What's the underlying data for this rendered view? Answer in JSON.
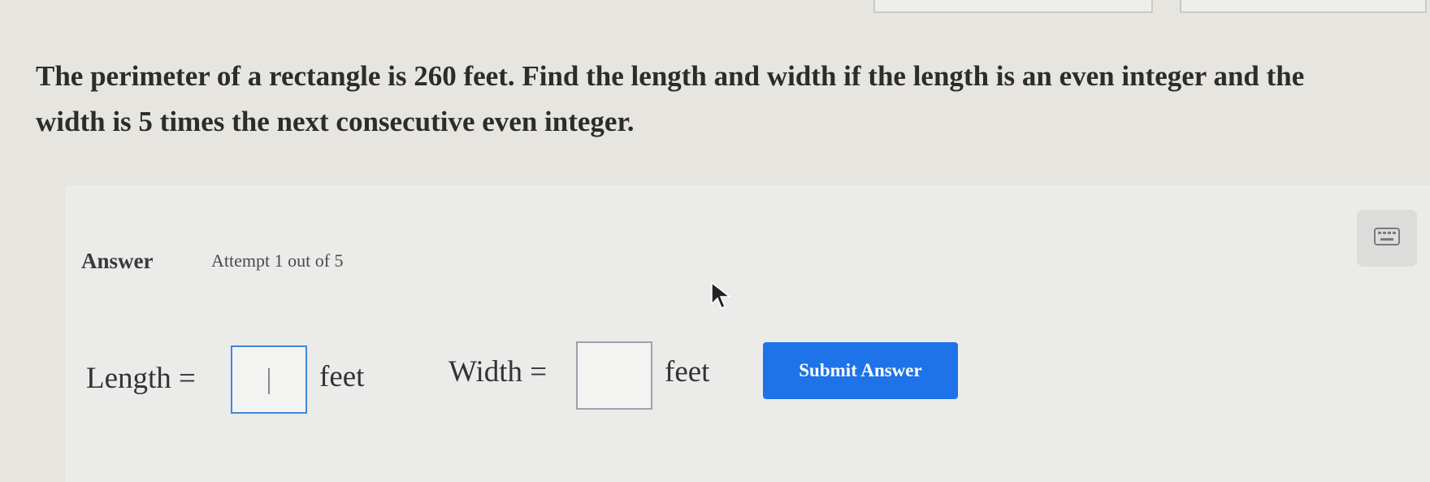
{
  "question": {
    "text": "The perimeter of a rectangle is 260 feet. Find the length and width if the length is an even integer and the width is 5 times the next consecutive even integer."
  },
  "answer_section": {
    "title": "Answer",
    "attempt": "Attempt 1 out of 5"
  },
  "fields": {
    "length_label": "Length =",
    "length_value": "",
    "length_unit": "feet",
    "width_label": "Width =",
    "width_value": "",
    "width_unit": "feet"
  },
  "submit": {
    "label": "Submit Answer"
  },
  "icons": {
    "keyboard": "keyboard-icon",
    "cursor": "mouse-pointer-icon"
  },
  "colors": {
    "accent": "#1e73e8",
    "active_border": "#3f86da"
  }
}
